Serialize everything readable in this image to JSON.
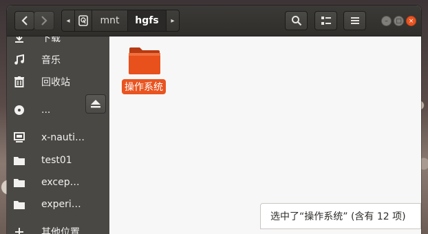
{
  "toolbar": {
    "back_icon": "chevron-left-icon",
    "forward_icon": "chevron-right-icon",
    "search_icon": "search-icon",
    "view_icon": "list-view-icon",
    "menu_icon": "hamburger-menu-icon"
  },
  "pathbar": {
    "left_arrow": "◂",
    "right_arrow": "▸",
    "crumbs": [
      {
        "label": "",
        "icon": "drive-icon"
      },
      {
        "label": "mnt"
      },
      {
        "label": "hgfs",
        "active": true
      }
    ]
  },
  "window_controls": {
    "minimize": "–",
    "maximize": "□",
    "close": "×"
  },
  "sidebar": {
    "items": [
      {
        "label": "下载",
        "icon": "download-icon"
      },
      {
        "label": "音乐",
        "icon": "music-icon"
      },
      {
        "label": "回收站",
        "icon": "trash-icon"
      },
      {
        "label": "...",
        "icon": "disc-icon"
      },
      {
        "label": "x-nauti…",
        "icon": "computer-icon"
      },
      {
        "label": "test01",
        "icon": "folder-icon"
      },
      {
        "label": "excep…",
        "icon": "folder-icon"
      },
      {
        "label": "experi…",
        "icon": "folder-icon"
      },
      {
        "label": "其他位置",
        "icon": "plus-icon"
      }
    ],
    "eject_icon": "eject-icon"
  },
  "content": {
    "files": [
      {
        "name": "操作系统",
        "type": "folder",
        "selected": true
      }
    ]
  },
  "status": {
    "text": "选中了“操作系统” (含有 12 项)"
  },
  "colors": {
    "accent": "#e95420",
    "sidebar": "#4a4845",
    "headerbar": "#3b3a37"
  }
}
